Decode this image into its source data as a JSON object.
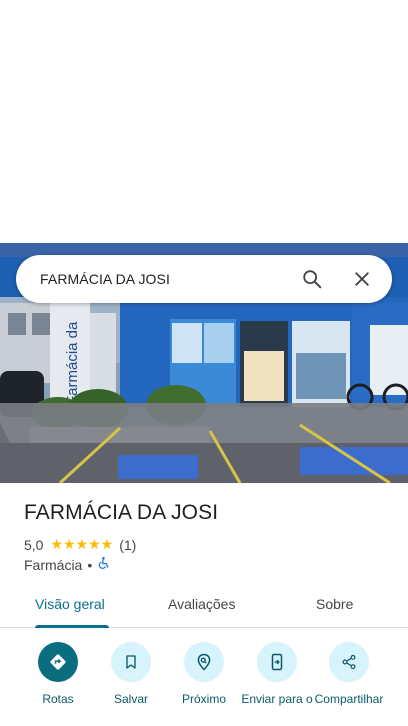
{
  "search": {
    "query": "FARMÁCIA DA JOSI"
  },
  "place": {
    "name": "FARMÁCIA DA JOSI",
    "rating": "5,0",
    "stars": "★★★★★",
    "reviews_count": "(1)",
    "category": "Farmácia",
    "separator": "•",
    "accessibility_icon": "wheelchair-icon"
  },
  "storefront_sign": "Farmácia da",
  "tabs": [
    {
      "label": "Visão geral",
      "active": true
    },
    {
      "label": "Avaliações",
      "active": false
    },
    {
      "label": "Sobre",
      "active": false
    }
  ],
  "actions": [
    {
      "label": "Rotas",
      "icon": "directions-icon"
    },
    {
      "label": "Salvar",
      "icon": "bookmark-icon"
    },
    {
      "label": "Próximo",
      "icon": "nearby-icon"
    },
    {
      "label": "Enviar para o",
      "icon": "send-to-phone-icon"
    },
    {
      "label": "Compartilhar",
      "icon": "share-icon"
    }
  ],
  "colors": {
    "accent": "#0b6e8c",
    "action_bg": "#d7f3fb",
    "primary_action_bg": "#0b6e7f",
    "star": "#fbbc04"
  }
}
